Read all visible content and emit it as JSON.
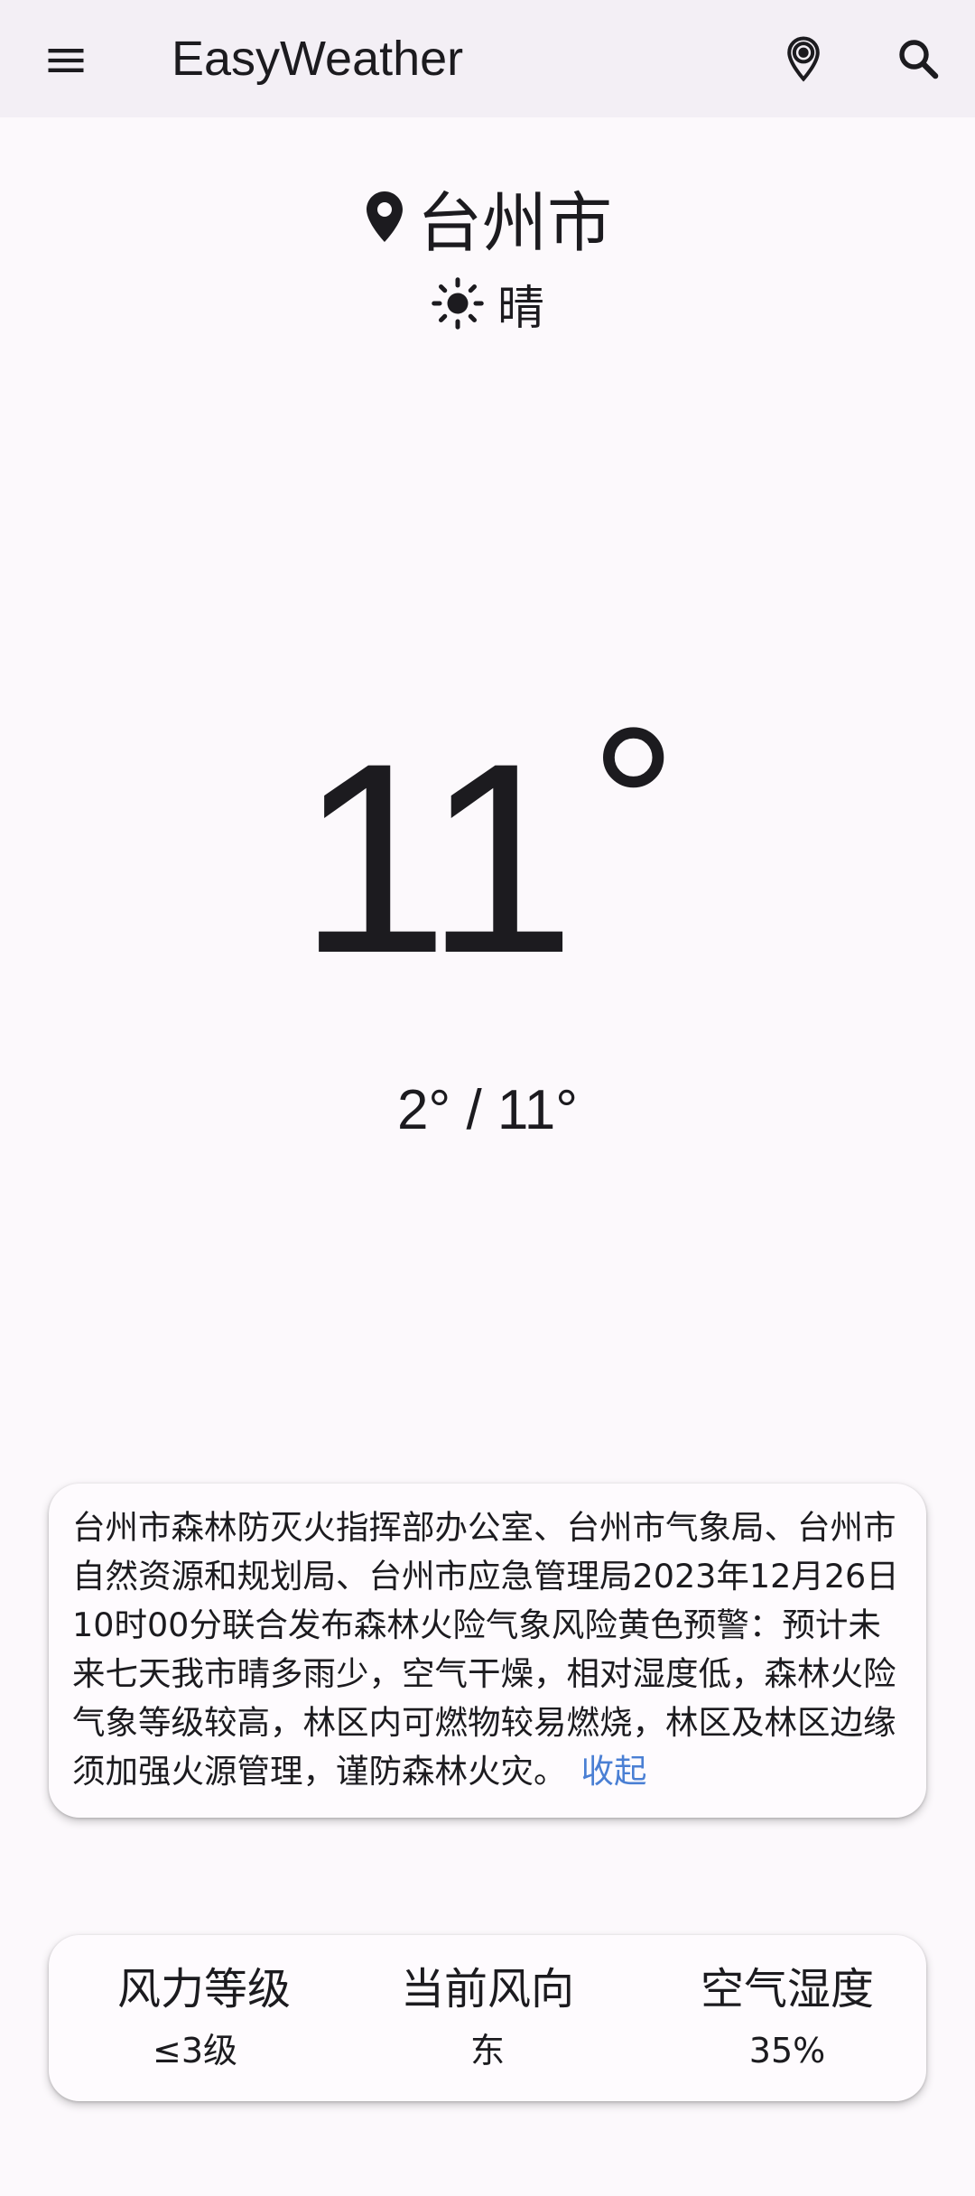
{
  "app_bar": {
    "title": "EasyWeather",
    "menu_icon": "menu-icon",
    "locate_icon": "location-pin-icon",
    "search_icon": "search-icon",
    "background": "#f3eff5"
  },
  "location": {
    "city": "台州市",
    "icon": "location-pin-icon"
  },
  "condition": {
    "text": "晴",
    "icon": "sun-icon"
  },
  "temperature": {
    "current": "11",
    "degree_symbol": "°",
    "range": "2° / 11°"
  },
  "alert": {
    "text": "台州市森林防灭火指挥部办公室、台州市气象局、台州市自然资源和规划局、台州市应急管理局2023年12月26日10时00分联合发布森林火险气象风险黄色预警：预计未来七天我市晴多雨少，空气干燥，相对湿度低，森林火险气象等级较高，林区内可燃物较易燃烧，林区及林区边缘须加强火源管理，谨防森林火灾。",
    "collapse_label": "收起",
    "link_color": "#4a7fd4"
  },
  "details": [
    {
      "label": "风力等级",
      "value": "≤3级"
    },
    {
      "label": "当前风向",
      "value": "东"
    },
    {
      "label": "空气湿度",
      "value": "35%"
    }
  ]
}
